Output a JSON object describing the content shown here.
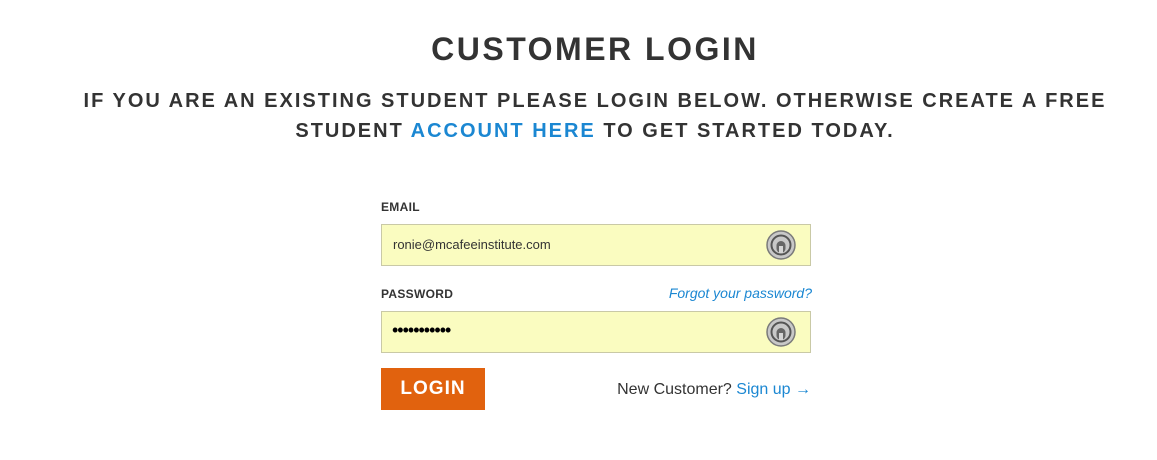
{
  "page": {
    "title": "CUSTOMER LOGIN",
    "intro_before": "IF YOU ARE AN EXISTING STUDENT PLEASE LOGIN BELOW. OTHERWISE CREATE A FREE STUDENT",
    "intro_link": "ACCOUNT HERE",
    "intro_after": "TO GET STARTED TODAY."
  },
  "form": {
    "email_label": "EMAIL",
    "email_value": "ronie@mcafeeinstitute.com",
    "password_label": "PASSWORD",
    "password_value": "•••••••••••",
    "forgot_link": "Forgot your password?",
    "login_button": "LOGIN",
    "new_customer_text": "New Customer?",
    "signup_link": "Sign up →",
    "field_icon": "password-manager-icon"
  },
  "colors": {
    "text": "#333333",
    "link": "#1b87d2",
    "button": "#e1620e",
    "autofill_background": "#fafcc0"
  }
}
